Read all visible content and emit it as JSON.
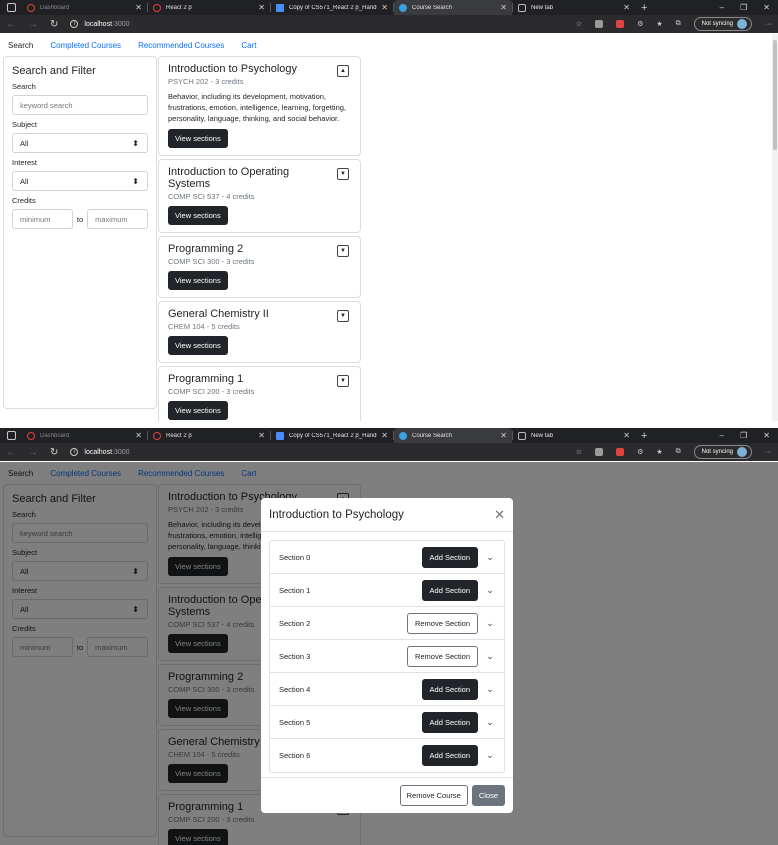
{
  "browser": {
    "tabs": [
      {
        "label": "Dashboard",
        "favicon": "ring-red",
        "dim": true
      },
      {
        "label": "React 2 β",
        "favicon": "ring-red",
        "dim": false
      },
      {
        "label": "Copy of CS571_React 2 β_Handu",
        "favicon": "doc-blue",
        "dim": false
      },
      {
        "label": "Course Search",
        "favicon": "globe-blue",
        "active": true
      },
      {
        "label": "New tab",
        "favicon": "newtab",
        "dim": false
      }
    ],
    "url_host": "localhost",
    "url_port": ":3000",
    "sync_label": "Not syncing"
  },
  "nav": {
    "search": "Search",
    "completed": "Completed Courses",
    "recommended": "Recommended Courses",
    "cart": "Cart"
  },
  "filter": {
    "title": "Search and Filter",
    "search_label": "Search",
    "search_placeholder": "keyword search",
    "subject_label": "Subject",
    "subject_value": "All",
    "interest_label": "Interest",
    "interest_value": "All",
    "credits_label": "Credits",
    "min_placeholder": "minimum",
    "to": "to",
    "max_placeholder": "maximum"
  },
  "courses": [
    {
      "title": "Introduction to Psychology",
      "sub": "PSYCH 202 - 3 credits",
      "desc": "Behavior, including its development, motivation, frustrations, emotion, intelligence, learning, forgetting, personality, language, thinking, and social behavior.",
      "expanded": true,
      "button": "View sections"
    },
    {
      "title": "Introduction to Operating Systems",
      "sub": "COMP SCI 537 - 4 credits",
      "desc": "",
      "expanded": false,
      "button": "View sections"
    },
    {
      "title": "Programming 2",
      "sub": "COMP SCI 300 - 3 credits",
      "desc": "",
      "expanded": false,
      "button": "View sections"
    },
    {
      "title": "General Chemistry II",
      "sub": "CHEM 104 - 5 credits",
      "desc": "",
      "expanded": false,
      "button": "View sections"
    },
    {
      "title": "Programming 1",
      "sub": "COMP SCI 200 - 3 credits",
      "desc": "",
      "expanded": false,
      "button": "View sections"
    }
  ],
  "modal": {
    "title": "Introduction to Psychology",
    "sections": [
      {
        "label": "Section 0",
        "action": "Add Section",
        "kind": "add"
      },
      {
        "label": "Section 1",
        "action": "Add Section",
        "kind": "add"
      },
      {
        "label": "Section 2",
        "action": "Remove Section",
        "kind": "remove"
      },
      {
        "label": "Section 3",
        "action": "Remove Section",
        "kind": "remove"
      },
      {
        "label": "Section 4",
        "action": "Add Section",
        "kind": "add"
      },
      {
        "label": "Section 5",
        "action": "Add Section",
        "kind": "add"
      },
      {
        "label": "Section 6",
        "action": "Add Section",
        "kind": "add"
      }
    ],
    "remove_course": "Remove Course",
    "close": "Close"
  },
  "colors": {
    "link": "#0d6efd",
    "dark_button": "#212529",
    "secondary": "#6c757d"
  }
}
